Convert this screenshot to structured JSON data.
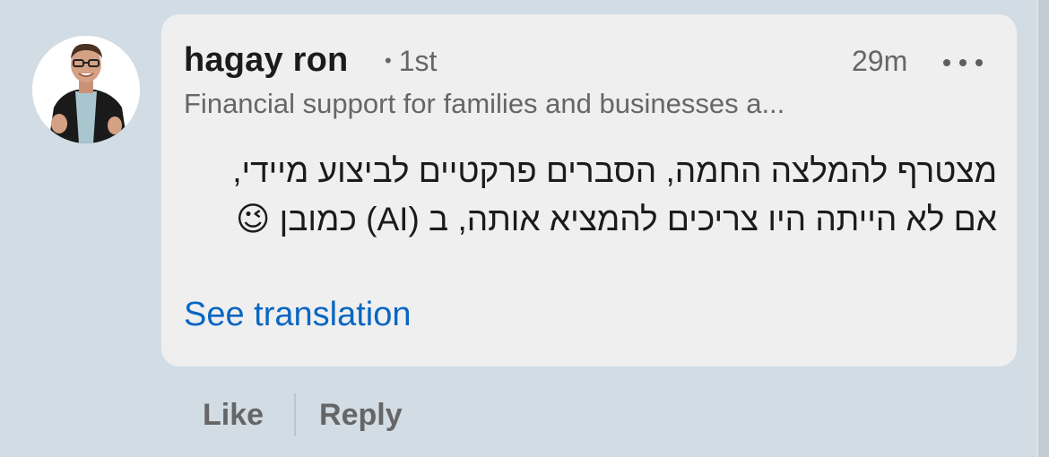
{
  "comment": {
    "author_name": "hagay ron",
    "degree_dot": "•",
    "connection_degree": "1st",
    "timestamp": "29m",
    "headline": "Financial support for families and businesses a...",
    "text": "מצטרף להמלצה החמה, הסברים פרקטיים לביצוע מיידי, אם לא הייתה היו צריכים להמציא אותה, ב (AI) כמובן 😉",
    "see_translation_label": "See translation"
  },
  "actions": {
    "like_label": "Like",
    "reply_label": "Reply"
  },
  "icons": {
    "more": "more-options-icon",
    "avatar": "avatar-photo"
  },
  "colors": {
    "background": "#d2dce4",
    "bubble": "#efefef",
    "link": "#0a66c2",
    "secondary_text": "#666666",
    "primary_text": "#1b1b1b"
  }
}
